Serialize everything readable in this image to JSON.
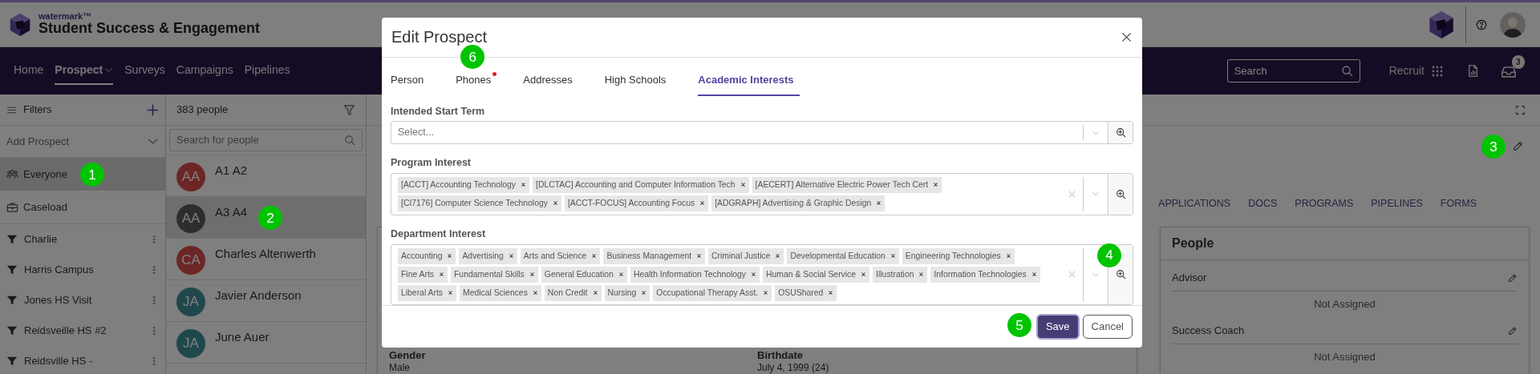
{
  "header": {
    "brand_small": "watermark™",
    "brand": "Student Success & Engagement"
  },
  "nav": {
    "links": [
      {
        "label": "Home",
        "selected": false
      },
      {
        "label": "Prospect",
        "selected": true,
        "dropdown": true
      },
      {
        "label": "Surveys",
        "selected": false
      },
      {
        "label": "Campaigns",
        "selected": false
      },
      {
        "label": "Pipelines",
        "selected": false
      }
    ],
    "search_placeholder": "Search",
    "app_switcher": "Recruit",
    "inbox_count": "3"
  },
  "sidebar": {
    "title": "Filters",
    "add_prospect": "Add Prospect",
    "views": [
      {
        "label": "Everyone",
        "kind": "people",
        "selected": true,
        "callout": "1"
      },
      {
        "label": "Caseload",
        "kind": "caseload",
        "selected": false
      }
    ],
    "filters": [
      {
        "label": "Charlie"
      },
      {
        "label": "Harris Campus"
      },
      {
        "label": "Jones HS Visit"
      },
      {
        "label": "Reidsveille HS #2"
      },
      {
        "label": "Reidsville HS -"
      }
    ]
  },
  "people_list": {
    "count": "383 people",
    "search_placeholder": "Search for people",
    "people": [
      {
        "initials": "AA",
        "name": "A1 A2",
        "color": "#6c2626",
        "selected": false
      },
      {
        "initials": "AA",
        "name": "A3 A4",
        "color": "#2d2d2d",
        "selected": true,
        "callout": "2"
      },
      {
        "initials": "CA",
        "name": "Charles Altenwerth",
        "color": "#6c2626",
        "selected": false
      },
      {
        "initials": "JA",
        "name": "Javier Anderson",
        "color": "#1f484d",
        "selected": false
      },
      {
        "initials": "JA",
        "name": "June Auer",
        "color": "#1f484d",
        "selected": false
      }
    ]
  },
  "profile": {
    "edit_callout": "3",
    "tabs": [
      "APPLICATIONS",
      "DOCS",
      "PROGRAMS",
      "PIPELINES",
      "FORMS"
    ],
    "details": [
      {
        "label": "Gender",
        "value": "Male"
      },
      {
        "label": "Birthdate",
        "value": "July 4, 1999 (24)"
      }
    ],
    "people_card": {
      "title": "People",
      "roles": [
        {
          "label": "Advisor",
          "value": "Not Assigned"
        },
        {
          "label": "Success Coach",
          "value": "Not Assigned"
        }
      ]
    }
  },
  "modal": {
    "title": "Edit Prospect",
    "tabs": [
      {
        "label": "Person",
        "selected": false,
        "alert": false
      },
      {
        "label": "Phones",
        "selected": false,
        "alert": true,
        "callout": "6"
      },
      {
        "label": "Addresses",
        "selected": false,
        "alert": false
      },
      {
        "label": "High Schools",
        "selected": false,
        "alert": false
      },
      {
        "label": "Academic Interests",
        "selected": true,
        "alert": false
      }
    ],
    "fields": [
      {
        "label": "Intended Start Term",
        "placeholder": "Select..."
      },
      {
        "label": "Program Interest",
        "chips": [
          "[ACCT] Accounting Technology",
          "[DLCTAC] Accounting and Computer Information Tech",
          "[AECERT] Alternative Electric Power Tech Cert",
          "[CI7176] Computer Science Technology",
          "[ACCT-FOCUS] Accounting Focus",
          "[ADGRAPH] Advertising & Graphic Design"
        ]
      },
      {
        "label": "Department Interest",
        "zoom_callout": "4",
        "chips": [
          "Accounting",
          "Advertising",
          "Arts and Science",
          "Business Management",
          "Criminal Justice",
          "Developmental Education",
          "Engineering Technologies",
          "Fine Arts",
          "Fundamental Skills",
          "General Education",
          "Health Information Technology",
          "Human & Social Service",
          "Illustration",
          "Information Technologies",
          "Liberal Arts",
          "Medical Sciences",
          "Non Credit",
          "Nursing",
          "Occupational Therapy Asst.",
          "OSUShared"
        ]
      }
    ],
    "buttons": [
      {
        "label": "Save",
        "kind": "primary",
        "callout": "5"
      },
      {
        "label": "Cancel",
        "kind": "secondary"
      }
    ]
  }
}
